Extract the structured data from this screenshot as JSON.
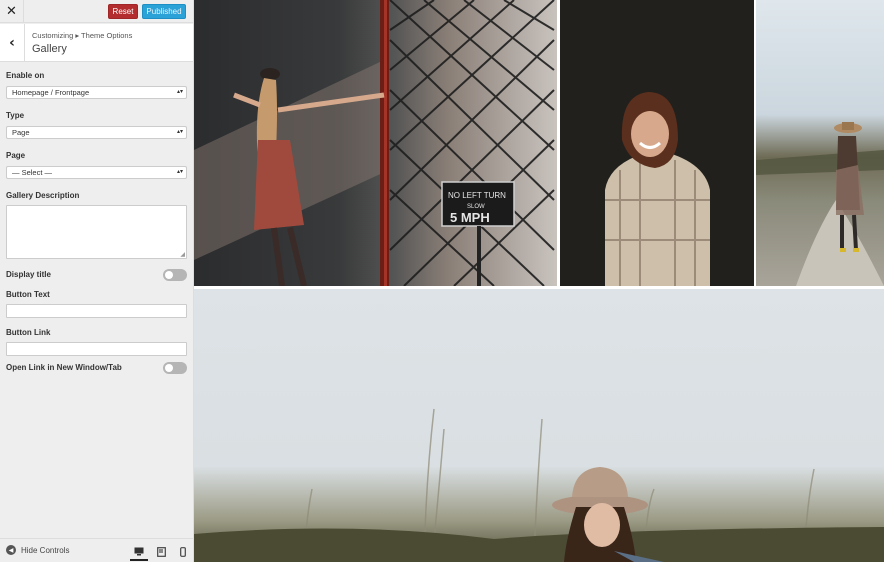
{
  "topbar": {
    "close_glyph": "✕",
    "reset_label": "Reset",
    "publish_label": "Published"
  },
  "header": {
    "back_glyph": "‹",
    "breadcrumb": "Customizing ▸ Theme Options",
    "title": "Gallery"
  },
  "fields": {
    "enable_on": {
      "label": "Enable on",
      "value": "Homepage / Frontpage"
    },
    "type": {
      "label": "Type",
      "value": "Page"
    },
    "page": {
      "label": "Page",
      "value": "— Select —"
    },
    "description": {
      "label": "Gallery Description",
      "value": ""
    },
    "display_title": {
      "label": "Display title",
      "on": false
    },
    "button_text": {
      "label": "Button Text",
      "value": ""
    },
    "button_link": {
      "label": "Button Link",
      "value": ""
    },
    "open_new_tab": {
      "label": "Open Link in New Window/Tab",
      "on": false
    }
  },
  "footer": {
    "hide_controls_label": "Hide Controls",
    "devices": [
      "desktop-icon",
      "tablet-icon",
      "mobile-icon"
    ],
    "active_device": "desktop"
  },
  "preview": {
    "photo_sign_lines": [
      "NO LEFT TURN",
      "SLOW",
      "5 MPH"
    ]
  },
  "colors": {
    "reset": "#b32d2e",
    "publish": "#2aa1d7",
    "sidebar_bg": "#eeeeee"
  }
}
